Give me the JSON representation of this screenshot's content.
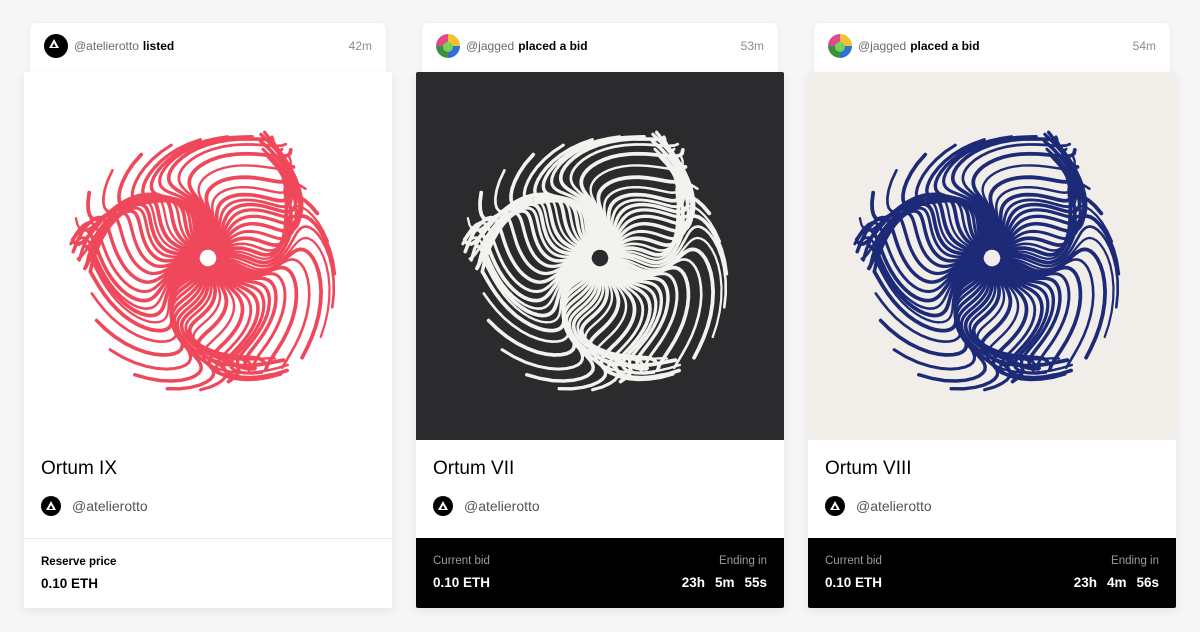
{
  "cards": [
    {
      "activity": {
        "user": "@atelierotto",
        "action": "listed",
        "time": "42m",
        "avatar": "foundation-logo-icon"
      },
      "artwork": {
        "background": "#ffffff",
        "ink": "#f0485b",
        "icon": "ortum-swirl-artwork"
      },
      "title": "Ortum IX",
      "creator": "@atelierotto",
      "footer": {
        "style": "light",
        "label": "Reserve price",
        "value": "0.10 ETH"
      }
    },
    {
      "activity": {
        "user": "@jagged",
        "action": "placed a bid",
        "time": "53m",
        "avatar": "colorful-avatar-icon"
      },
      "artwork": {
        "background": "#2b2b2d",
        "ink": "#f2f2ee",
        "icon": "ortum-swirl-artwork"
      },
      "title": "Ortum VII",
      "creator": "@atelierotto",
      "footer": {
        "style": "dark",
        "label": "Current bid",
        "value": "0.10 ETH",
        "ending_label": "Ending in",
        "countdown": [
          "23h",
          "5m",
          "55s"
        ]
      }
    },
    {
      "activity": {
        "user": "@jagged",
        "action": "placed a bid",
        "time": "54m",
        "avatar": "colorful-avatar-icon"
      },
      "artwork": {
        "background": "#f1ede8",
        "ink": "#1c2a78",
        "icon": "ortum-swirl-artwork"
      },
      "title": "Ortum VIII",
      "creator": "@atelierotto",
      "footer": {
        "style": "dark",
        "label": "Current bid",
        "value": "0.10 ETH",
        "ending_label": "Ending in",
        "countdown": [
          "23h",
          "4m",
          "56s"
        ]
      }
    }
  ]
}
